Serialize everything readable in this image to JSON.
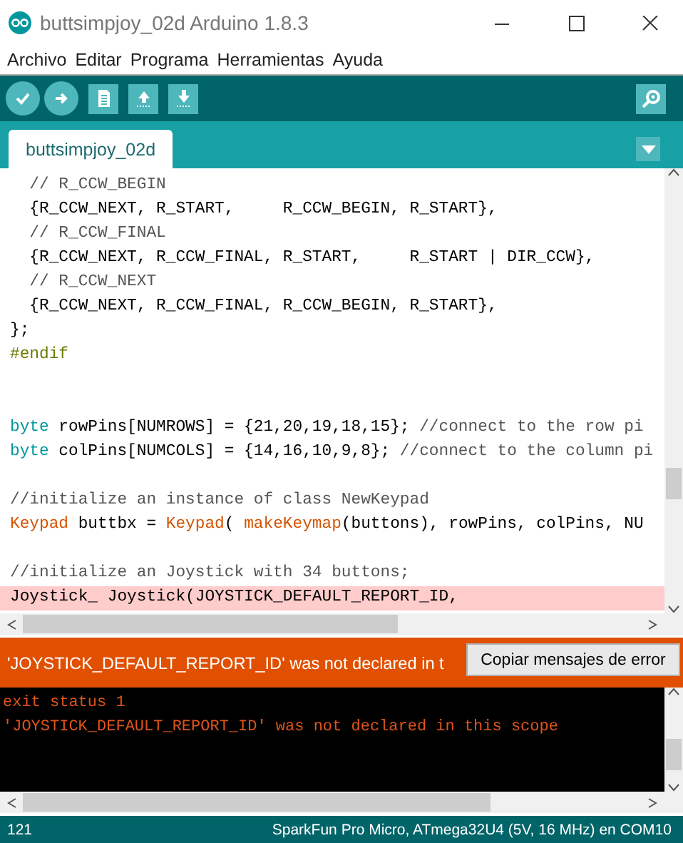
{
  "window": {
    "title": "buttsimpjoy_02d Arduino 1.8.3"
  },
  "menu": [
    "Archivo",
    "Editar",
    "Programa",
    "Herramientas",
    "Ayuda"
  ],
  "toolbar": [
    {
      "kind": "verify"
    },
    {
      "kind": "upload"
    },
    {
      "kind": "new"
    },
    {
      "kind": "open"
    },
    {
      "kind": "save"
    }
  ],
  "tabs": [
    {
      "label": "buttsimpjoy_02d",
      "selected": true
    }
  ],
  "code": [
    {
      "highlighted": false,
      "tokens": [
        {
          "kind": "comment",
          "text": "  // R_CCW_BEGIN"
        }
      ]
    },
    {
      "highlighted": false,
      "tokens": [
        {
          "kind": "plain",
          "text": "  {R_CCW_NEXT, R_START,     R_CCW_BEGIN, R_START},"
        }
      ]
    },
    {
      "highlighted": false,
      "tokens": [
        {
          "kind": "comment",
          "text": "  // R_CCW_FINAL"
        }
      ]
    },
    {
      "highlighted": false,
      "tokens": [
        {
          "kind": "plain",
          "text": "  {R_CCW_NEXT, R_CCW_FINAL, R_START,     R_START | DIR_CCW},"
        }
      ]
    },
    {
      "highlighted": false,
      "tokens": [
        {
          "kind": "comment",
          "text": "  // R_CCW_NEXT"
        }
      ]
    },
    {
      "highlighted": false,
      "tokens": [
        {
          "kind": "plain",
          "text": "  {R_CCW_NEXT, R_CCW_FINAL, R_CCW_BEGIN, R_START},"
        }
      ]
    },
    {
      "highlighted": false,
      "tokens": [
        {
          "kind": "plain",
          "text": "};"
        }
      ]
    },
    {
      "highlighted": false,
      "tokens": [
        {
          "kind": "preproc",
          "text": "#endif"
        }
      ]
    },
    {
      "highlighted": false
    },
    {
      "highlighted": false
    },
    {
      "highlighted": false,
      "tokens": [
        {
          "kind": "keyword",
          "text": "byte"
        },
        {
          "kind": "plain",
          "text": " rowPins[NUMROWS] = {21,20,19,18,15}; "
        },
        {
          "kind": "comment",
          "text": "//connect to the row pi"
        }
      ]
    },
    {
      "highlighted": false,
      "tokens": [
        {
          "kind": "keyword",
          "text": "byte"
        },
        {
          "kind": "plain",
          "text": " colPins[NUMCOLS] = {14,16,10,9,8}; "
        },
        {
          "kind": "comment",
          "text": "//connect to the column pi"
        }
      ]
    },
    {
      "highlighted": false
    },
    {
      "highlighted": false,
      "tokens": [
        {
          "kind": "comment",
          "text": "//initialize an instance of class NewKeypad"
        }
      ]
    },
    {
      "highlighted": false,
      "tokens": [
        {
          "kind": "type",
          "text": "Keypad"
        },
        {
          "kind": "plain",
          "text": " buttbx = "
        },
        {
          "kind": "type",
          "text": "Keypad"
        },
        {
          "kind": "plain",
          "text": "( "
        },
        {
          "kind": "function",
          "text": "makeKeymap"
        },
        {
          "kind": "plain",
          "text": "(buttons), rowPins, colPins, NU"
        }
      ]
    },
    {
      "highlighted": false
    },
    {
      "highlighted": false,
      "tokens": [
        {
          "kind": "comment",
          "text": "//initialize an Joystick with 34 buttons;"
        }
      ]
    },
    {
      "highlighted": true,
      "tokens": [
        {
          "kind": "plain",
          "text": "Joystick_ Joystick(JOYSTICK_DEFAULT_REPORT_ID,"
        }
      ]
    }
  ],
  "error_bar": {
    "message": "'JOYSTICK_DEFAULT_REPORT_ID' was not declared in t",
    "button": "Copiar mensajes de error"
  },
  "console": [
    "exit status 1",
    "'JOYSTICK_DEFAULT_REPORT_ID' was not declared in this scope"
  ],
  "status_bar": {
    "line": "121",
    "board": "SparkFun Pro Micro, ATmega32U4 (5V, 16 MHz) en COM10"
  }
}
